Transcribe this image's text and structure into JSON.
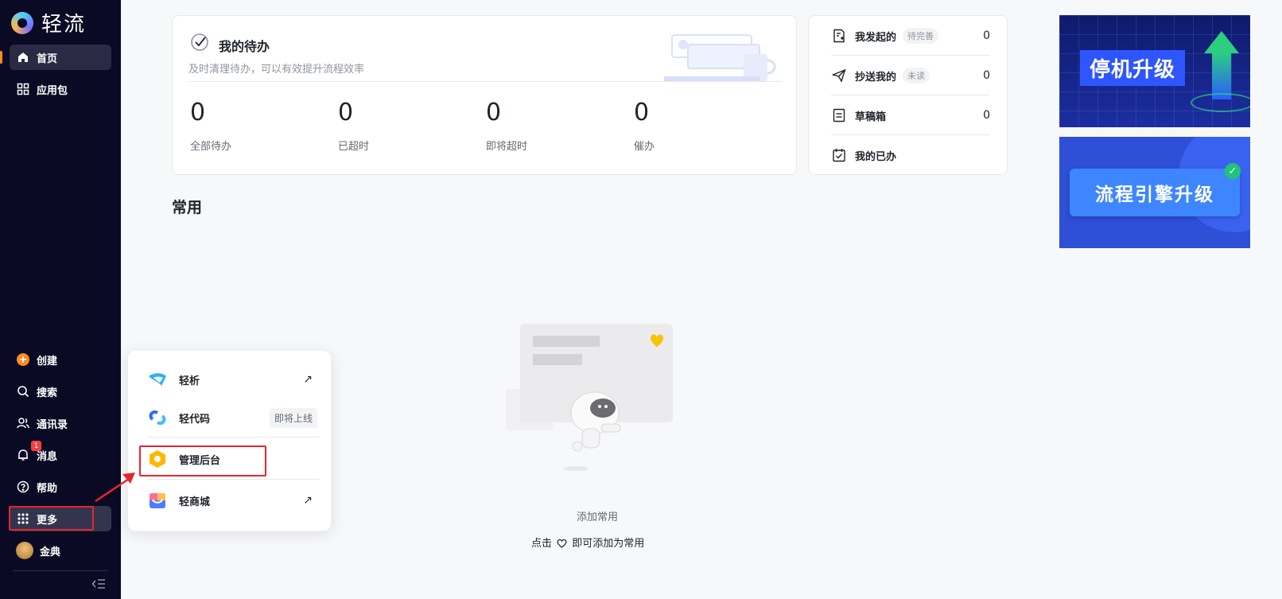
{
  "app": {
    "name": "轻流"
  },
  "sidebar": {
    "top_items": [
      {
        "label": "首页",
        "icon": "home-icon"
      },
      {
        "label": "应用包",
        "icon": "grid-icon"
      }
    ],
    "bottom_items": [
      {
        "label": "创建",
        "icon": "plus-circle-icon"
      },
      {
        "label": "搜索",
        "icon": "search-icon"
      },
      {
        "label": "通讯录",
        "icon": "contacts-icon"
      },
      {
        "label": "消息",
        "icon": "bell-icon",
        "badge": "1"
      },
      {
        "label": "帮助",
        "icon": "help-icon"
      },
      {
        "label": "更多",
        "icon": "apps-icon"
      },
      {
        "label": "金典",
        "icon": "avatar"
      }
    ]
  },
  "todo": {
    "title": "我的待办",
    "subtitle": "及时清理待办，可以有效提升流程效率",
    "stats": [
      {
        "value": "0",
        "label": "全部待办"
      },
      {
        "value": "0",
        "label": "已超时"
      },
      {
        "value": "0",
        "label": "即将超时"
      },
      {
        "value": "0",
        "label": "催办"
      }
    ]
  },
  "quick_list": [
    {
      "label": "我发起的",
      "tag": "待完善",
      "count": "0",
      "icon": "doc-plus-icon"
    },
    {
      "label": "抄送我的",
      "tag": "未读",
      "count": "0",
      "icon": "send-icon"
    },
    {
      "label": "草稿箱",
      "tag": "",
      "count": "0",
      "icon": "draft-icon"
    },
    {
      "label": "我的已办",
      "tag": "",
      "count": "",
      "icon": "calendar-check-icon"
    }
  ],
  "banners": [
    {
      "label": "停机升级"
    },
    {
      "label": "流程引擎升级"
    }
  ],
  "common": {
    "title": "常用",
    "empty_title": "添加常用",
    "empty_hint_prefix": "点击",
    "empty_hint_suffix": "即可添加为常用"
  },
  "more_menu": [
    {
      "label": "轻析",
      "icon": "qingxi-icon",
      "external": "↗"
    },
    {
      "label": "轻代码",
      "icon": "qingdaima-icon",
      "badge": "即将上线"
    },
    {
      "label": "管理后台",
      "icon": "admin-icon"
    },
    {
      "label": "轻商城",
      "icon": "mall-icon",
      "external": "↗"
    }
  ],
  "colors": {
    "sidebar_bg": "#0b0a24",
    "accent": "#ff8a1f",
    "highlight_box": "#e7262f"
  }
}
